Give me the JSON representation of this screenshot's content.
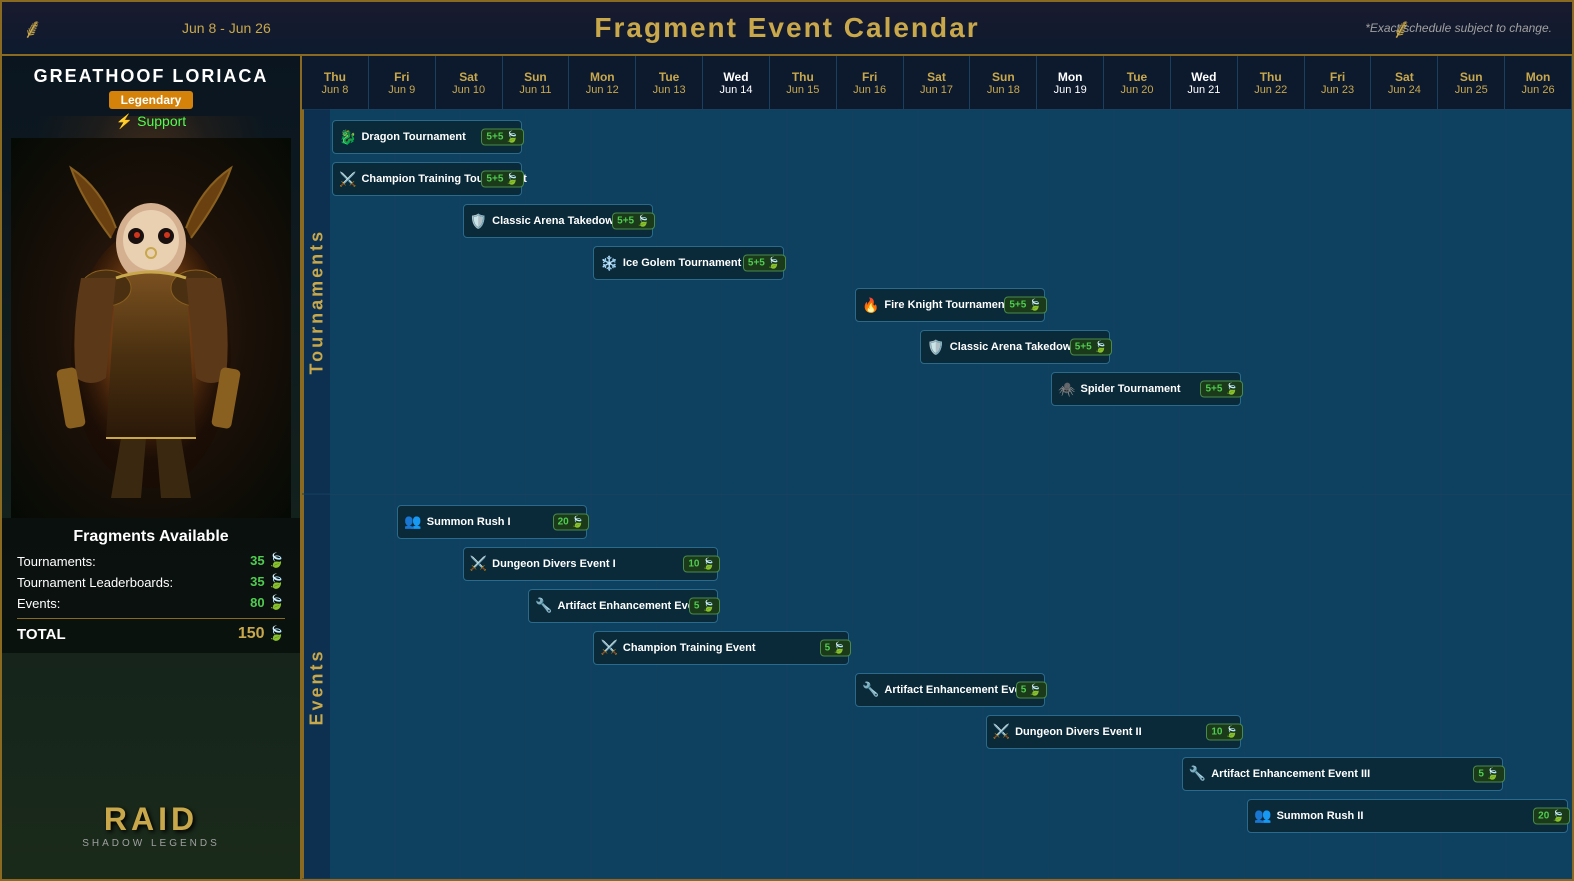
{
  "header": {
    "date_range": "Jun 8 - Jun 26",
    "title": "Fragment Event Calendar",
    "subtitle": "*Exact schedule subject to change.",
    "corner_left": "❧",
    "corner_right": "❧"
  },
  "character": {
    "name": "GREATHOOF LORIACA",
    "rarity": "Legendary",
    "role": "Support",
    "game": "RAID",
    "game_subtitle": "SHADOW LEGENDS"
  },
  "fragments": {
    "title": "Fragments Available",
    "rows": [
      {
        "label": "Tournaments:",
        "value": "35"
      },
      {
        "label": "Tournament Leaderboards:",
        "value": "35"
      },
      {
        "label": "Events:",
        "value": "80"
      }
    ],
    "total_label": "TOTAL",
    "total_value": "150"
  },
  "calendar": {
    "columns": [
      {
        "day": "Thu",
        "date": "Jun 8",
        "highlight": false
      },
      {
        "day": "Fri",
        "date": "Jun 9",
        "highlight": false
      },
      {
        "day": "Sat",
        "date": "Jun 10",
        "highlight": false
      },
      {
        "day": "Sun",
        "date": "Jun 11",
        "highlight": false
      },
      {
        "day": "Mon",
        "date": "Jun 12",
        "highlight": false
      },
      {
        "day": "Tue",
        "date": "Jun 13",
        "highlight": false
      },
      {
        "day": "Wed",
        "date": "Jun 14",
        "highlight": true
      },
      {
        "day": "Thu",
        "date": "Jun 15",
        "highlight": false
      },
      {
        "day": "Fri",
        "date": "Jun 16",
        "highlight": false
      },
      {
        "day": "Sat",
        "date": "Jun 17",
        "highlight": false
      },
      {
        "day": "Sun",
        "date": "Jun 18",
        "highlight": false
      },
      {
        "day": "Mon",
        "date": "Jun 19",
        "highlight": true
      },
      {
        "day": "Tue",
        "date": "Jun 20",
        "highlight": false
      },
      {
        "day": "Wed",
        "date": "Jun 21",
        "highlight": true
      },
      {
        "day": "Thu",
        "date": "Jun 22",
        "highlight": false
      },
      {
        "day": "Fri",
        "date": "Jun 23",
        "highlight": false
      },
      {
        "day": "Sat",
        "date": "Jun 24",
        "highlight": false
      },
      {
        "day": "Sun",
        "date": "Jun 25",
        "highlight": false
      },
      {
        "day": "Mon",
        "date": "Jun 26",
        "highlight": false
      }
    ],
    "sections": {
      "tournaments": {
        "label": "Tournaments",
        "events": [
          {
            "name": "Dragon Tournament",
            "start": 0,
            "span": 3,
            "row": 0,
            "fragments": "5+5",
            "icon": "🐉"
          },
          {
            "name": "Champion Training Tournament",
            "start": 0,
            "span": 3,
            "row": 1,
            "fragments": "5+5",
            "icon": "⚔️"
          },
          {
            "name": "Classic Arena Takedown I",
            "start": 2,
            "span": 3,
            "row": 2,
            "fragments": "5+5",
            "icon": "🛡️"
          },
          {
            "name": "Ice Golem Tournament",
            "start": 4,
            "span": 3,
            "row": 3,
            "fragments": "5+5",
            "icon": "❄️"
          },
          {
            "name": "Fire Knight Tournament",
            "start": 8,
            "span": 3,
            "row": 4,
            "fragments": "5+5",
            "icon": "🔥"
          },
          {
            "name": "Classic Arena Takedown II",
            "start": 9,
            "span": 3,
            "row": 5,
            "fragments": "5+5",
            "icon": "🛡️"
          },
          {
            "name": "Spider Tournament",
            "start": 11,
            "span": 3,
            "row": 6,
            "fragments": "5+5",
            "icon": "🕷️"
          }
        ]
      },
      "events": {
        "label": "Events",
        "events": [
          {
            "name": "Summon Rush I",
            "start": 1,
            "span": 3,
            "row": 0,
            "fragments": "20",
            "icon": "👥"
          },
          {
            "name": "Dungeon Divers Event I",
            "start": 2,
            "span": 4,
            "row": 1,
            "fragments": "10",
            "icon": "⚔️"
          },
          {
            "name": "Artifact Enhancement Event I",
            "start": 3,
            "span": 3,
            "row": 2,
            "fragments": "5",
            "icon": "🔧"
          },
          {
            "name": "Champion Training Event",
            "start": 4,
            "span": 4,
            "row": 3,
            "fragments": "5",
            "icon": "⚔️"
          },
          {
            "name": "Artifact Enhancement Event II",
            "start": 8,
            "span": 3,
            "row": 4,
            "fragments": "5",
            "icon": "🔧"
          },
          {
            "name": "Dungeon Divers  Event II",
            "start": 10,
            "span": 4,
            "row": 5,
            "fragments": "10",
            "icon": "⚔️"
          },
          {
            "name": "Artifact Enhancement Event III",
            "start": 13,
            "span": 5,
            "row": 6,
            "fragments": "5",
            "icon": "🔧"
          },
          {
            "name": "Summon Rush II",
            "start": 14,
            "span": 5,
            "row": 7,
            "fragments": "20",
            "icon": "👥"
          }
        ]
      }
    }
  }
}
